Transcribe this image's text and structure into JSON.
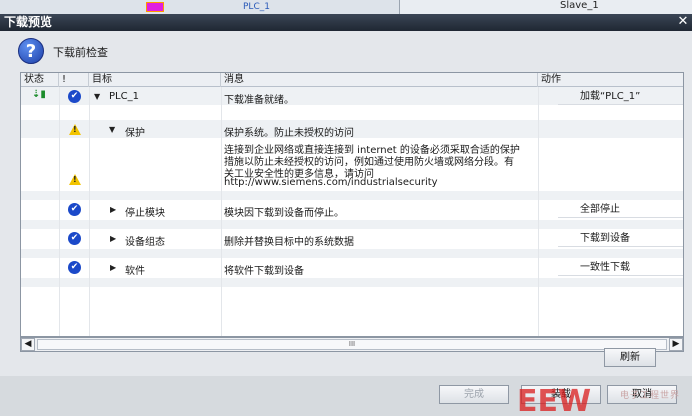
{
  "background": {
    "plc_label": "PLC_1",
    "slave_label": "Slave_1"
  },
  "dialog": {
    "title": "下载预览",
    "header_title": "下载前检查",
    "columns": [
      "状态",
      "!",
      "目标",
      "消息",
      "动作"
    ],
    "rows": [
      {
        "target": "PLC_1",
        "message": "下载准备就绪。",
        "action": "加载“PLC_1”",
        "status_icon": "download-icon",
        "check_icon": "ok-warning-icon",
        "expanded": true
      },
      {
        "target": "保护",
        "message": "保护系统。防止未授权的访问",
        "action": "",
        "check_icon": "warning-icon",
        "expanded": true
      },
      {
        "target": "",
        "message_lines": [
          "连接到企业网络或直接连接到 internet 的设备必须采取合适的保护",
          "措施以防止未经授权的访问，例如通过使用防火墙或网络分段。有",
          "关工业安全性的更多信息，请访问",
          "http://www.siemens.com/industrialsecurity"
        ],
        "check_icon": "warning-icon"
      },
      {
        "target": "停止模块",
        "message": "模块因下载到设备而停止。",
        "action": "全部停止",
        "check_icon": "ok-icon",
        "expanded": false
      },
      {
        "target": "设备组态",
        "message": "删除并替换目标中的系统数据",
        "action": "下载到设备",
        "check_icon": "ok-icon",
        "expanded": false
      },
      {
        "target": "软件",
        "message": "将软件下载到设备",
        "action": "一致性下载",
        "check_icon": "ok-icon",
        "expanded": false
      }
    ],
    "scroll_label": "III",
    "refresh_button": "刷新",
    "finish_button": "完成",
    "load_button": "装载",
    "cancel_button": "取消",
    "logo_text": "EEW",
    "watermark_text": "电子工程世界"
  },
  "colors": {
    "ok": "#1b49c9",
    "warning": "#f2c400",
    "title_bar": "#1f2733"
  }
}
